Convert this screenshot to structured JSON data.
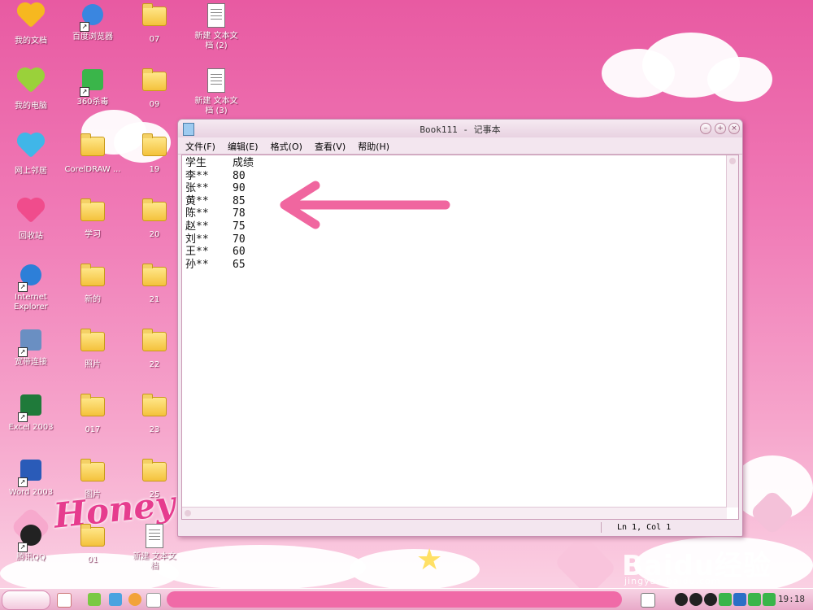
{
  "desktop": {
    "icons": [
      {
        "label": "我的文档",
        "kind": "heart",
        "color": "#f6b820"
      },
      {
        "label": "百度浏览器",
        "kind": "browser",
        "color": "#3a86e0"
      },
      {
        "label": "07",
        "kind": "folder"
      },
      {
        "label": "新建 文本文\n档 (2)",
        "kind": "doc"
      },
      {
        "label": "我的电脑",
        "kind": "heart",
        "color": "#9ad13a"
      },
      {
        "label": "360杀毒",
        "kind": "shield",
        "color": "#3ab54a"
      },
      {
        "label": "09",
        "kind": "folder"
      },
      {
        "label": "新建 文本文\n档 (3)",
        "kind": "doc"
      },
      {
        "label": "网上邻居",
        "kind": "heart",
        "color": "#40b6e8"
      },
      {
        "label": "CorelDRAW ...",
        "kind": "folder"
      },
      {
        "label": "19",
        "kind": "folder"
      },
      {
        "label": "回收站",
        "kind": "heart",
        "color": "#f04c8c"
      },
      {
        "label": "学习",
        "kind": "folder"
      },
      {
        "label": "20",
        "kind": "folder"
      },
      {
        "label": "Internet\nExplorer",
        "kind": "ie",
        "color": "#2d7fd8"
      },
      {
        "label": "新的",
        "kind": "folder"
      },
      {
        "label": "21",
        "kind": "folder"
      },
      {
        "label": "宽带连接",
        "kind": "net",
        "color": "#6a8fc2"
      },
      {
        "label": "照片",
        "kind": "folder"
      },
      {
        "label": "22",
        "kind": "folder"
      },
      {
        "label": "Excel 2003",
        "kind": "excel",
        "color": "#1f7a3a"
      },
      {
        "label": "017",
        "kind": "folder"
      },
      {
        "label": "23",
        "kind": "folder"
      },
      {
        "label": "Word 2003",
        "kind": "word",
        "color": "#2a5bb8"
      },
      {
        "label": "图片",
        "kind": "folder"
      },
      {
        "label": "25",
        "kind": "folder"
      },
      {
        "label": "腾讯QQ",
        "kind": "qq",
        "color": "#222"
      },
      {
        "label": "01",
        "kind": "folder"
      },
      {
        "label": "新建 文本文\n档",
        "kind": "doc"
      }
    ],
    "decor_text": "Honey"
  },
  "window": {
    "title": "Book111 - 记事本",
    "menus": [
      "文件(F)",
      "编辑(E)",
      "格式(O)",
      "查看(V)",
      "帮助(H)"
    ],
    "content": {
      "header": {
        "name": "学生",
        "score": "成绩"
      },
      "rows": [
        {
          "name": "李**",
          "score": "80"
        },
        {
          "name": "张**",
          "score": "90"
        },
        {
          "name": "黄**",
          "score": "85"
        },
        {
          "name": "陈**",
          "score": "78"
        },
        {
          "name": "赵**",
          "score": "75"
        },
        {
          "name": "刘**",
          "score": "70"
        },
        {
          "name": "王**",
          "score": "60"
        },
        {
          "name": "孙**",
          "score": "65"
        }
      ]
    },
    "status": "Ln 1, Col 1"
  },
  "taskbar": {
    "clock": "19:18"
  },
  "watermark": {
    "brand": "Baidu经验",
    "url": "jingyan.baidu.com"
  },
  "colors": {
    "arrow": "#f0669f",
    "accent": "#e85aa2"
  }
}
